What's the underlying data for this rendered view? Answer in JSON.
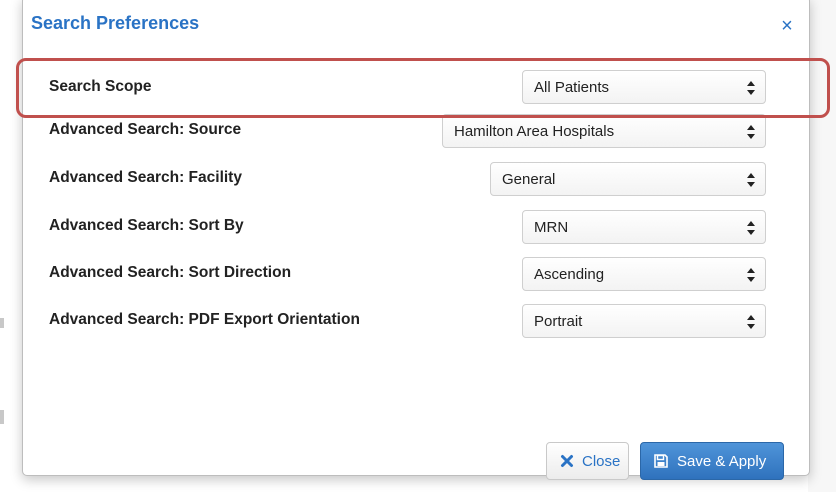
{
  "dialog": {
    "title": "Search Preferences",
    "close_icon": "×"
  },
  "settings": [
    {
      "label": "Search Scope",
      "value": "All Patients"
    },
    {
      "label": "Advanced Search: Source",
      "value": "Hamilton Area Hospitals"
    },
    {
      "label": "Advanced Search: Facility",
      "value": "General"
    },
    {
      "label": "Advanced Search: Sort By",
      "value": "MRN"
    },
    {
      "label": "Advanced Search: Sort Direction",
      "value": "Ascending"
    },
    {
      "label": "Advanced Search: PDF Export Orientation",
      "value": "Portrait"
    }
  ],
  "footer": {
    "close_label": "Close",
    "save_label": "Save & Apply"
  },
  "colors": {
    "title": "#2a73c5",
    "highlight": "#c0504d",
    "primary_button": "#3a7fc8"
  }
}
